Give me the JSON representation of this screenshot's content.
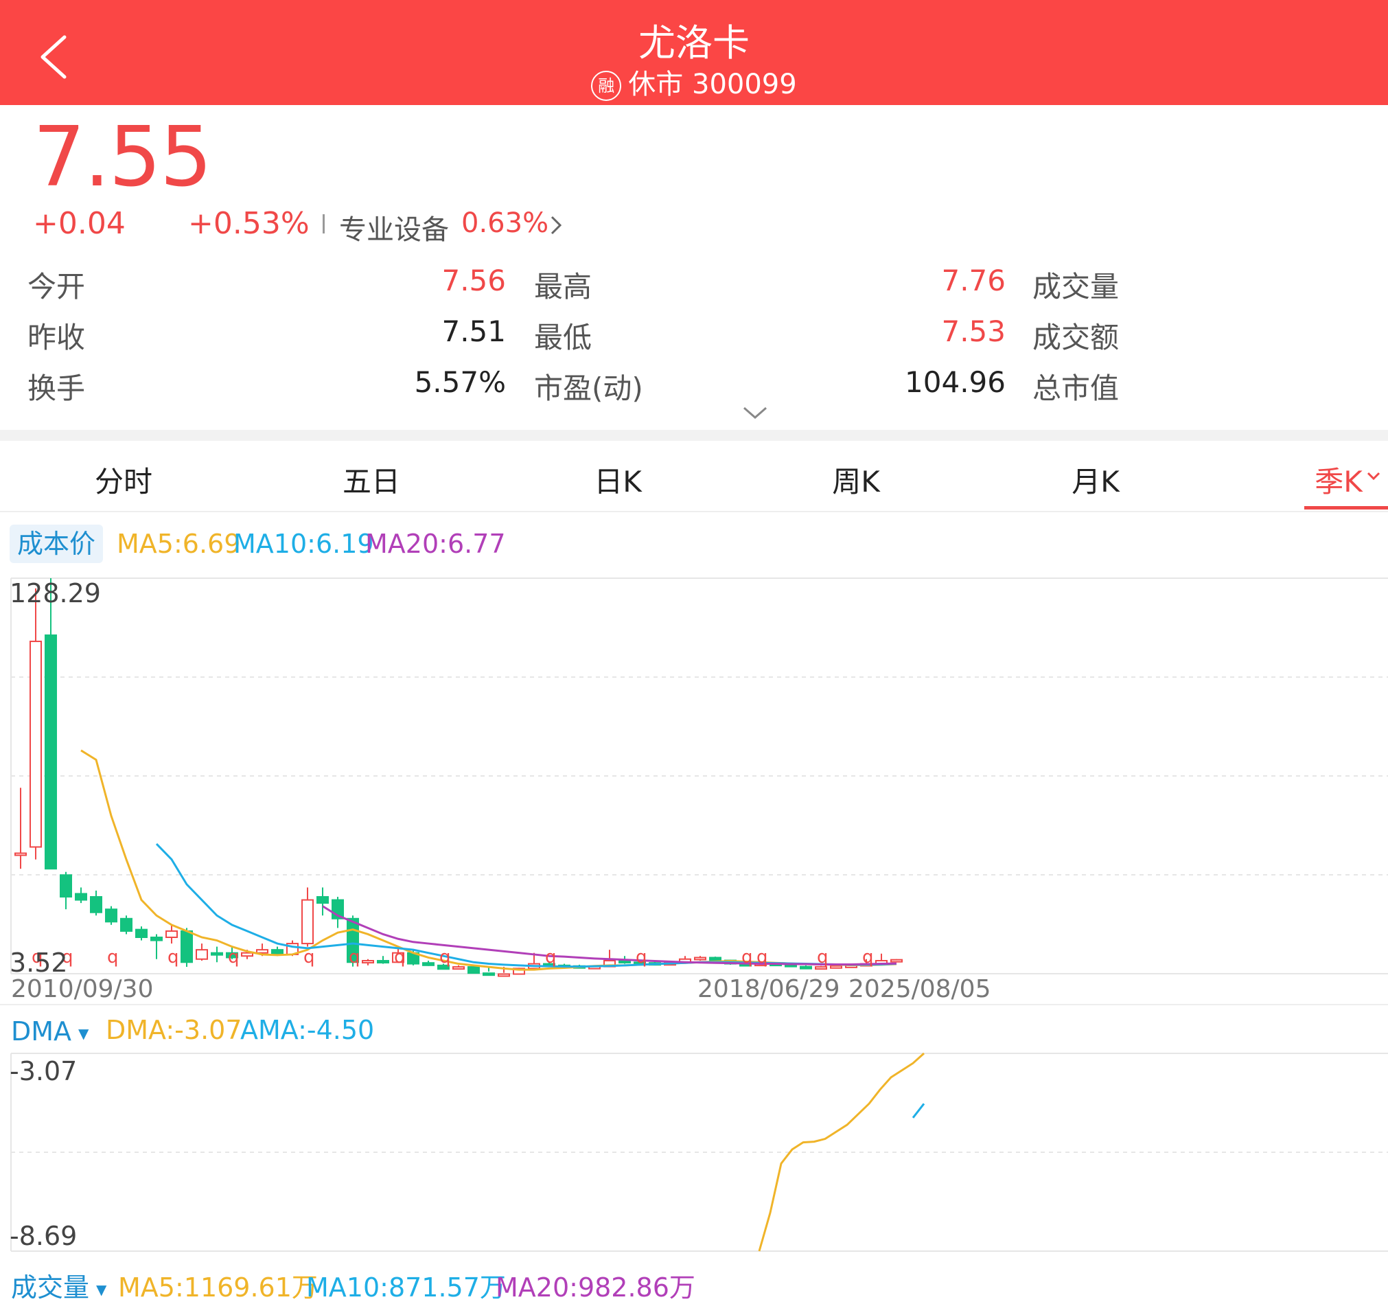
{
  "header": {
    "title": "尤洛卡",
    "rong_badge": "融",
    "status_code": "休市 300099"
  },
  "quote": {
    "price": "7.55",
    "change": "+0.04",
    "change_pct": "+0.53%",
    "sector": "专业设备",
    "sector_pct": "0.63%"
  },
  "stats": {
    "open_label": "今开",
    "open": "7.56",
    "high_label": "最高",
    "high": "7.76",
    "volume_label": "成交量",
    "prev_close_label": "昨收",
    "prev_close": "7.51",
    "low_label": "最低",
    "low": "7.53",
    "amount_label": "成交额",
    "turnover_label": "换手",
    "turnover": "5.57%",
    "pe_label": "市盈(动)",
    "pe": "104.96",
    "mktcap_label": "总市值"
  },
  "tabs": [
    "分时",
    "五日",
    "日K",
    "周K",
    "月K",
    "季K"
  ],
  "active_tab": "季K",
  "main_chart": {
    "cost_button": "成本价",
    "ma5": "MA5:6.69",
    "ma10": "MA10:6.19",
    "ma20": "MA20:6.77",
    "y_max_label": "128.29",
    "y_min_label": "3.52",
    "date_start": "2010/09/30",
    "date_mid": "2018/06/29",
    "date_end": "2025/08/05",
    "marker_glyph": "q"
  },
  "dma_panel": {
    "name": "DMA",
    "dma": "DMA:-3.07",
    "ama": "AMA:-4.50",
    "y_top": "-3.07",
    "y_bottom": "-8.69"
  },
  "volume_panel": {
    "name": "成交量",
    "ma5": "MA5:1169.61万",
    "ma10": "MA10:871.57万",
    "ma20": "MA20:982.86万"
  },
  "colors": {
    "header_bg": "#fb4645",
    "up": "#f04848",
    "down": "#14c27f",
    "ma5": "#f0b429",
    "ma10": "#1eaee6",
    "ma20": "#b13fb8"
  },
  "chart_data": {
    "type": "candlestick",
    "y_range": [
      3.52,
      128.29
    ],
    "dma_range": [
      -8.69,
      -3.07
    ],
    "candles": [
      {
        "o": 40,
        "h": 61,
        "l": 35,
        "c": 40
      },
      {
        "o": 42,
        "h": 125,
        "l": 38,
        "c": 108
      },
      {
        "o": 110,
        "h": 128.29,
        "l": 35,
        "c": 35
      },
      {
        "o": 33,
        "h": 34,
        "l": 22,
        "c": 26
      },
      {
        "o": 27,
        "h": 29,
        "l": 24,
        "c": 25
      },
      {
        "o": 26,
        "h": 28,
        "l": 20,
        "c": 21
      },
      {
        "o": 22,
        "h": 23,
        "l": 17,
        "c": 18
      },
      {
        "o": 19,
        "h": 20,
        "l": 14,
        "c": 15
      },
      {
        "o": 15.5,
        "h": 16.5,
        "l": 12,
        "c": 13
      },
      {
        "o": 13,
        "h": 14,
        "l": 6,
        "c": 12
      },
      {
        "o": 13,
        "h": 17,
        "l": 11,
        "c": 15
      },
      {
        "o": 15,
        "h": 16,
        "l": 3.52,
        "c": 5
      },
      {
        "o": 6,
        "h": 11,
        "l": 5.5,
        "c": 9
      },
      {
        "o": 8,
        "h": 10,
        "l": 5,
        "c": 7.5
      },
      {
        "o": 8,
        "h": 10,
        "l": 6,
        "c": 6.5
      },
      {
        "o": 7,
        "h": 9,
        "l": 6,
        "c": 8
      },
      {
        "o": 8,
        "h": 11,
        "l": 7,
        "c": 9
      },
      {
        "o": 9,
        "h": 10,
        "l": 7,
        "c": 7.5
      },
      {
        "o": 7.5,
        "h": 12,
        "l": 7,
        "c": 11
      },
      {
        "o": 11,
        "h": 29,
        "l": 10,
        "c": 25
      },
      {
        "o": 26,
        "h": 29,
        "l": 20,
        "c": 24
      },
      {
        "o": 25,
        "h": 26,
        "l": 16,
        "c": 19
      },
      {
        "o": 19,
        "h": 20,
        "l": 3.6,
        "c": 5
      },
      {
        "o": 5,
        "h": 6,
        "l": 4,
        "c": 5.5
      },
      {
        "o": 5.5,
        "h": 7,
        "l": 4.5,
        "c": 5
      },
      {
        "o": 5,
        "h": 10,
        "l": 4.8,
        "c": 8
      },
      {
        "o": 8,
        "h": 9,
        "l": 4,
        "c": 4.5
      },
      {
        "o": 4.8,
        "h": 5.5,
        "l": 3.8,
        "c": 4
      },
      {
        "o": 4,
        "h": 4.5,
        "l": 2.5,
        "c": 2.8
      },
      {
        "o": 3,
        "h": 4,
        "l": 2.5,
        "c": 3.5
      },
      {
        "o": 3.5,
        "h": 3.8,
        "l": 1.2,
        "c": 1.5
      },
      {
        "o": 1.5,
        "h": 2,
        "l": 1,
        "c": 1.3
      },
      {
        "o": 1.2,
        "h": 1.6,
        "l": 0.8,
        "c": 1.2
      },
      {
        "o": 1.2,
        "h": 3.5,
        "l": 1,
        "c": 3
      },
      {
        "o": 3,
        "h": 8,
        "l": 2.5,
        "c": 4.5
      },
      {
        "o": 4.5,
        "h": 5,
        "l": 3.5,
        "c": 4
      },
      {
        "o": 4,
        "h": 4.5,
        "l": 3.5,
        "c": 3.8
      },
      {
        "o": 3.8,
        "h": 4.2,
        "l": 3,
        "c": 3.5
      },
      {
        "o": 3.5,
        "h": 4,
        "l": 3,
        "c": 3.6
      },
      {
        "o": 3.6,
        "h": 9,
        "l": 3.4,
        "c": 5.5
      },
      {
        "o": 5.5,
        "h": 7,
        "l": 4.5,
        "c": 5
      },
      {
        "o": 5,
        "h": 5.5,
        "l": 4.5,
        "c": 4.8
      },
      {
        "o": 4.8,
        "h": 5.2,
        "l": 4.4,
        "c": 4.6
      },
      {
        "o": 4.6,
        "h": 5,
        "l": 4.2,
        "c": 4.8
      },
      {
        "o": 4.8,
        "h": 7,
        "l": 4.5,
        "c": 6
      },
      {
        "o": 6,
        "h": 7,
        "l": 5.5,
        "c": 6.5
      },
      {
        "o": 6.5,
        "h": 6.8,
        "l": 5.2,
        "c": 5.6
      },
      {
        "o": 5.6,
        "h": 5.8,
        "l": 4.2,
        "c": 4.5
      },
      {
        "o": 4.5,
        "h": 5,
        "l": 4,
        "c": 4.4
      },
      {
        "o": 4.4,
        "h": 5,
        "l": 4,
        "c": 4.6
      },
      {
        "o": 4.6,
        "h": 5,
        "l": 4.2,
        "c": 4.4
      },
      {
        "o": 4.4,
        "h": 4.8,
        "l": 3,
        "c": 3.6
      },
      {
        "o": 3.6,
        "h": 4,
        "l": 2.5,
        "c": 3
      },
      {
        "o": 3,
        "h": 3.8,
        "l": 2.8,
        "c": 3.5
      },
      {
        "o": 3.5,
        "h": 4,
        "l": 3,
        "c": 3.8
      },
      {
        "o": 3.8,
        "h": 4.2,
        "l": 3.3,
        "c": 4
      },
      {
        "o": 4,
        "h": 6,
        "l": 3.8,
        "c": 4.5
      },
      {
        "o": 4.5,
        "h": 7.76,
        "l": 4.2,
        "c": 5.5
      },
      {
        "o": 5.5,
        "h": 6,
        "l": 5,
        "c": 5.8
      }
    ],
    "ma_lines": {
      "ma5": [
        null,
        null,
        null,
        null,
        73,
        70,
        52,
        38,
        25,
        20,
        17,
        15,
        13,
        12,
        10,
        8.5,
        7.5,
        7.3,
        7.5,
        9,
        12,
        14.5,
        15.5,
        14,
        12,
        10,
        8,
        6.5,
        5.5,
        4.5,
        4,
        3.5,
        3,
        2.6,
        2.6,
        3,
        3.2,
        3.5,
        3.8,
        4,
        4,
        4.2,
        4.4,
        4.6,
        4.8,
        5,
        5.2,
        5.4,
        5.2,
        5,
        4.8,
        4.6,
        4.4,
        4.3,
        4.2,
        4.1,
        4.1,
        4.2,
        4.4
      ],
      "ma10": [
        null,
        null,
        null,
        null,
        null,
        null,
        null,
        null,
        null,
        43,
        38,
        30,
        25,
        20,
        17,
        15,
        13,
        11,
        10,
        9.5,
        10,
        10.5,
        11,
        10.5,
        10,
        9.5,
        9,
        8,
        7,
        6,
        5,
        4.5,
        4.2,
        4,
        3.8,
        3.7,
        3.6,
        3.6,
        3.7,
        3.8,
        4,
        4.2,
        4.4,
        4.6,
        4.8,
        5,
        5,
        5,
        4.9,
        4.8,
        4.7,
        4.6,
        4.5,
        4.4,
        4.3,
        4.2,
        4.2,
        4.3,
        4.5
      ],
      "ma20": [
        null,
        null,
        null,
        null,
        null,
        null,
        null,
        null,
        null,
        null,
        null,
        null,
        null,
        null,
        null,
        null,
        null,
        null,
        null,
        null,
        23,
        20,
        18,
        16,
        14,
        12.5,
        11.5,
        11,
        10.5,
        10,
        9.5,
        9,
        8.5,
        8,
        7.5,
        7,
        6.8,
        6.5,
        6.2,
        6,
        5.8,
        5.6,
        5.4,
        5.2,
        5,
        4.9,
        4.8,
        4.7,
        4.6,
        4.5,
        4.5,
        4.4,
        4.4,
        4.3,
        4.3,
        4.3,
        4.4,
        4.5,
        4.6
      ]
    },
    "dma_series": {
      "dma": [
        -8.69,
        -7.6,
        -6.2,
        -5.8,
        -5.6,
        -5.58,
        -5.5,
        -5.3,
        -5.1,
        -4.8,
        -4.5,
        -4.1,
        -3.75,
        -3.55,
        -3.35,
        -3.07
      ],
      "ama": [
        -4.9,
        -4.5
      ]
    },
    "y_labels": [
      "128.29",
      "3.52"
    ],
    "x_labels": [
      "2010/09/30",
      "2018/06/29",
      "2025/08/05"
    ]
  }
}
